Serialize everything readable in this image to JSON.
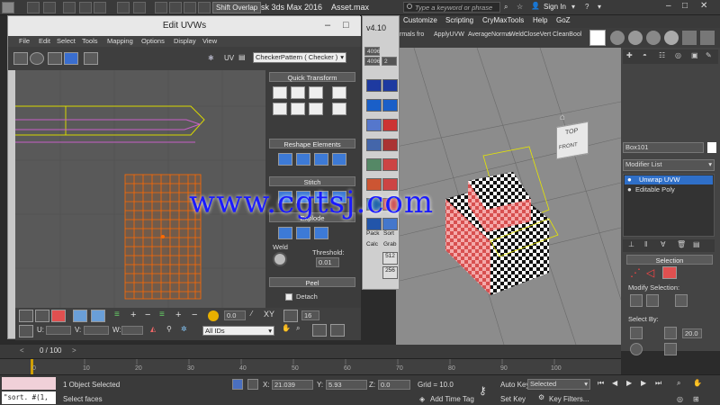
{
  "top": {
    "shift_overlap": "Shift Overlap",
    "app_title": "sk 3ds Max 2016",
    "file_title": "Asset.max",
    "search_placeholder": "Type a keyword or phrase",
    "sign_in": "Sign In"
  },
  "menu": [
    "Customize",
    "Scripting",
    "CryMaxTools",
    "Help",
    "GoZ"
  ],
  "toolbar2": [
    "rmals fro",
    "ApplyUVW",
    "AverageNorma",
    "WeldCloseVert",
    "CleanBool"
  ],
  "uvw": {
    "title": "Edit UVWs",
    "menu": [
      "File",
      "Edit",
      "Select",
      "Tools",
      "Mapping",
      "Options",
      "Display",
      "View"
    ],
    "uv_label": "UV",
    "checker": "CheckerPattern  ( Checker )",
    "rollouts": {
      "quick_transform": "Quick Transform",
      "reshape": "Reshape Elements",
      "stitch": "Stitch",
      "explode": "Explode",
      "weld": "Weld",
      "threshold_label": "Threshold:",
      "threshold_value": "0.01",
      "peel": "Peel",
      "detach": "Detach"
    },
    "bottom": {
      "u_label": "U:",
      "v_label": "V:",
      "w_label": "W:",
      "xy": "XY",
      "value1": "0.0",
      "value2": "16",
      "ids": "All IDs",
      "value3": "0.0"
    }
  },
  "v410": {
    "version": "v4.10",
    "res1": "4096",
    "res2": "4096",
    "val": "2",
    "labels": [
      "Pack",
      "Sort",
      "Calc",
      "Grab"
    ],
    "num1": "512",
    "num2": "256"
  },
  "viewport": {
    "cube_top": "TOP",
    "cube_front": "FRONT"
  },
  "right_panel": {
    "object_name": "Box101",
    "modifier_list": "Modifier List",
    "stack": [
      "Unwrap UVW",
      "Editable Poly"
    ],
    "selection_title": "Selection",
    "modify_selection": "Modify Selection:",
    "select_by": "Select By:",
    "angle": "20.0"
  },
  "timeline": {
    "frame": "0 / 100",
    "ticks": [
      "0",
      "10",
      "20",
      "30",
      "40",
      "50",
      "60",
      "70",
      "80",
      "90",
      "100"
    ]
  },
  "status": {
    "script": "\"sort. #(1,",
    "objects": "1 Object Selected",
    "hint": "Select faces",
    "x_label": "X:",
    "x": "21.039",
    "y_label": "Y:",
    "y": "5.93",
    "z_label": "Z:",
    "z": "0.0",
    "grid": "Grid = 10.0",
    "add_time_tag": "Add Time Tag",
    "auto_key": "Auto Key",
    "selected": "Selected",
    "set_key": "Set Key",
    "key_filters": "Key Filters..."
  },
  "watermark": "www.cgtsj.com",
  "colors": {
    "uv_orange": "#ff6a00",
    "checker_pink": "#e46464",
    "watermark": "#1a1aff"
  }
}
